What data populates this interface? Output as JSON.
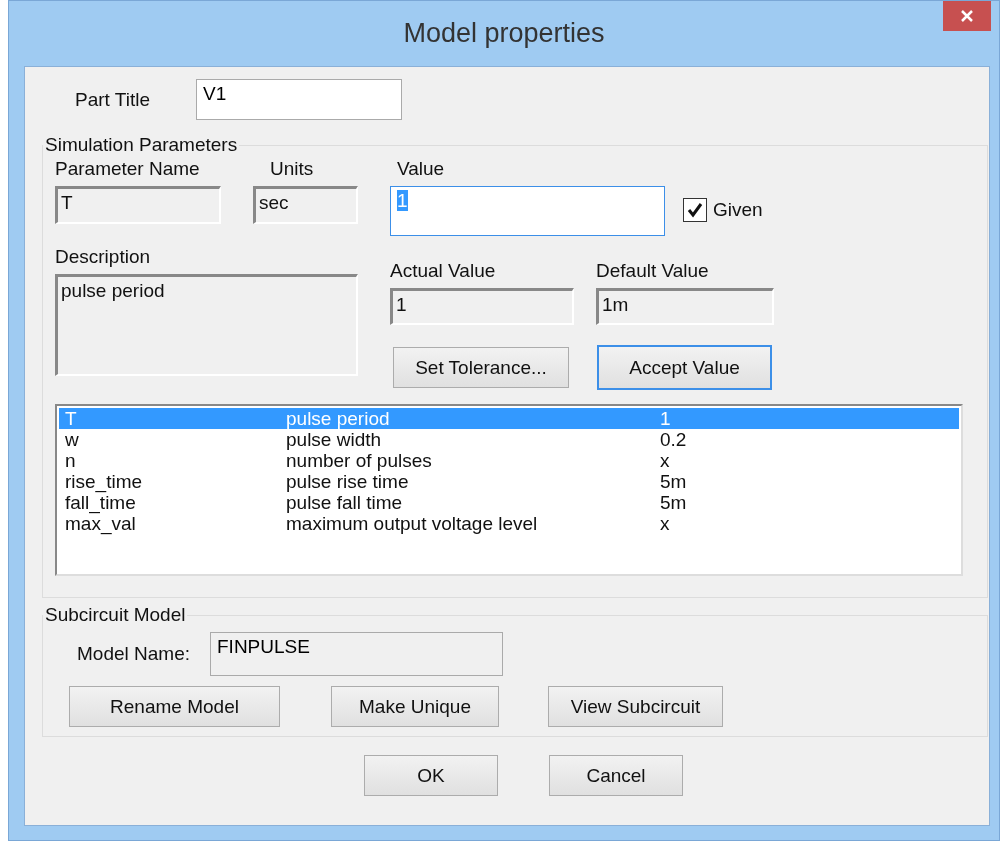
{
  "window": {
    "title": "Model properties"
  },
  "part_title": {
    "label": "Part Title",
    "value": "V1"
  },
  "simulation_parameters": {
    "title": "Simulation Parameters",
    "parameter_name": {
      "label": "Parameter Name",
      "value": "T"
    },
    "units": {
      "label": "Units",
      "value": "sec"
    },
    "value": {
      "label": "Value",
      "value": "1",
      "focused": true
    },
    "given": {
      "label": "Given",
      "checked": true
    },
    "description": {
      "label": "Description",
      "value": "pulse period"
    },
    "actual_value": {
      "label": "Actual Value",
      "value": "1"
    },
    "default_value": {
      "label": "Default Value",
      "value": "1m"
    },
    "buttons": [
      {
        "label": "Set Tolerance...",
        "default": false
      },
      {
        "label": "Accept Value",
        "default": true
      }
    ],
    "rows": [
      {
        "name": "T",
        "description": "pulse period",
        "value": "1",
        "selected": true
      },
      {
        "name": "w",
        "description": "pulse width",
        "value": "0.2",
        "selected": false
      },
      {
        "name": "n",
        "description": "number of pulses",
        "value": "x",
        "selected": false
      },
      {
        "name": "rise_time",
        "description": "pulse rise time",
        "value": "5m",
        "selected": false
      },
      {
        "name": "fall_time",
        "description": "pulse fall time",
        "value": "5m",
        "selected": false
      },
      {
        "name": "max_val",
        "description": "maximum output voltage level",
        "value": "x",
        "selected": false
      }
    ]
  },
  "subcircuit_model": {
    "title": "Subcircuit Model",
    "model_name": {
      "label": "Model Name:",
      "value": "FINPULSE"
    },
    "buttons": [
      "Rename Model",
      "Make Unique",
      "View Subcircuit"
    ]
  },
  "buttons": [
    "OK",
    "Cancel"
  ]
}
